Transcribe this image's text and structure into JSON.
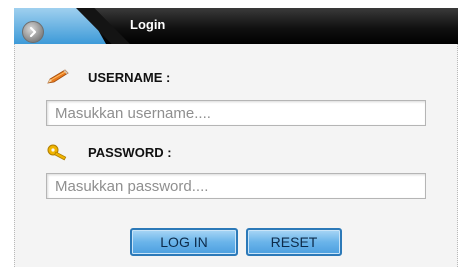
{
  "header": {
    "title": "Login"
  },
  "form": {
    "username_label": "USERNAME :",
    "username_placeholder": "Masukkan username....",
    "password_label": "PASSWORD :",
    "password_placeholder": "Masukkan password....",
    "login_button": "LOG IN",
    "reset_button": "RESET"
  },
  "icons": {
    "header": "chevron-right-icon",
    "username": "pencil-icon",
    "password": "key-icon"
  },
  "colors": {
    "header_accent": "#3d9ad8",
    "button": "#6ab4ea",
    "icon_orange": "#e87a1d"
  }
}
